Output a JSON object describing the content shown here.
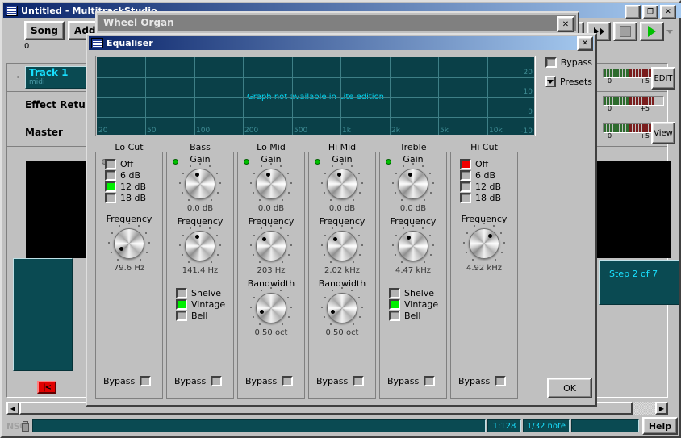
{
  "main_window": {
    "title": "Untitled - MultitrackStudio",
    "sys": {
      "minimize": "_",
      "maximize": "❐",
      "close": "✕"
    },
    "toolbar": {
      "song": "Song",
      "add_track": "Add T"
    },
    "ruler": {
      "start_label": "0"
    },
    "tracks": [
      {
        "name": "Track 1",
        "subtitle": "midi",
        "selected": true,
        "button": "EDIT"
      },
      {
        "name": "Effect Return",
        "subtitle": "",
        "selected": false,
        "button": ""
      },
      {
        "name": "Master",
        "subtitle": "",
        "selected": false,
        "button": "View"
      }
    ],
    "meter_scale": {
      "low": "0",
      "high": "+5"
    },
    "step_indicator": "Step 2 of 7",
    "rewind_button": "|<",
    "status": {
      "app_tag": "NSG",
      "field_tempo": "1:128",
      "field_note": "1/32 note",
      "help": "Help"
    }
  },
  "wheel_organ_window": {
    "title": "Wheel Organ",
    "close": "✕"
  },
  "equaliser_window": {
    "title": "Equaliser",
    "close": "✕",
    "bypass_label": "Bypass",
    "presets_label": "Presets",
    "ok_label": "OK",
    "graph": {
      "message": "Graph not available in Lite edition",
      "freq_labels": [
        "20",
        "50",
        "100",
        "200",
        "500",
        "1k",
        "2k",
        "5k",
        "10k"
      ],
      "db_labels": [
        "20",
        "10",
        "0",
        "-10"
      ]
    },
    "bands": [
      {
        "title": "Lo Cut",
        "led": "off",
        "slope_options": [
          {
            "label": "Off",
            "state": "off"
          },
          {
            "label": "6 dB",
            "state": "off"
          },
          {
            "label": "12 dB",
            "state": "green"
          },
          {
            "label": "18 dB",
            "state": "off"
          }
        ],
        "gain_label": "",
        "gain_value": "",
        "freq_label": "Frequency",
        "freq_value": "79.6 Hz",
        "freq_angle": -125,
        "bandwidth_label": "",
        "bandwidth_value": "",
        "shape_options": [],
        "bypass_label": "Bypass"
      },
      {
        "title": "Bass",
        "led": "on",
        "slope_options": [],
        "gain_label": "Gain",
        "gain_value": "0.0 dB",
        "gain_angle": -18,
        "freq_label": "Frequency",
        "freq_value": "141.4 Hz",
        "freq_angle": -18,
        "bandwidth_label": "",
        "bandwidth_value": "",
        "shape_options": [
          {
            "label": "Shelve",
            "state": "off"
          },
          {
            "label": "Vintage",
            "state": "green"
          },
          {
            "label": "Bell",
            "state": "off"
          }
        ],
        "bypass_label": "Bypass"
      },
      {
        "title": "Lo Mid",
        "led": "on",
        "slope_options": [],
        "gain_label": "Gain",
        "gain_value": "0.0 dB",
        "gain_angle": -18,
        "freq_label": "Frequency",
        "freq_value": "203 Hz",
        "freq_angle": -42,
        "bandwidth_label": "Bandwidth",
        "bandwidth_value": "0.50 oct",
        "bandwidth_angle": -110,
        "shape_options": [],
        "bypass_label": "Bypass"
      },
      {
        "title": "Hi Mid",
        "led": "on",
        "slope_options": [],
        "gain_label": "Gain",
        "gain_value": "0.0 dB",
        "gain_angle": -18,
        "freq_label": "Frequency",
        "freq_value": "2.02 kHz",
        "freq_angle": -42,
        "bandwidth_label": "Bandwidth",
        "bandwidth_value": "0.50 oct",
        "bandwidth_angle": -110,
        "shape_options": [],
        "bypass_label": "Bypass"
      },
      {
        "title": "Treble",
        "led": "on",
        "slope_options": [],
        "gain_label": "Gain",
        "gain_value": "0.0 dB",
        "gain_angle": -18,
        "freq_label": "Frequency",
        "freq_value": "4.47 kHz",
        "freq_angle": -28,
        "bandwidth_label": "",
        "bandwidth_value": "",
        "shape_options": [
          {
            "label": "Shelve",
            "state": "off"
          },
          {
            "label": "Vintage",
            "state": "green"
          },
          {
            "label": "Bell",
            "state": "off"
          }
        ],
        "bypass_label": "Bypass"
      },
      {
        "title": "Hi Cut",
        "led": "none",
        "slope_options": [
          {
            "label": "Off",
            "state": "red"
          },
          {
            "label": "6 dB",
            "state": "off"
          },
          {
            "label": "12 dB",
            "state": "off"
          },
          {
            "label": "18 dB",
            "state": "off"
          }
        ],
        "gain_label": "",
        "gain_value": "",
        "freq_label": "Frequency",
        "freq_value": "4.92 kHz",
        "freq_angle": 38,
        "bandwidth_label": "",
        "bandwidth_value": "",
        "shape_options": [],
        "bypass_label": "Bypass"
      }
    ]
  }
}
